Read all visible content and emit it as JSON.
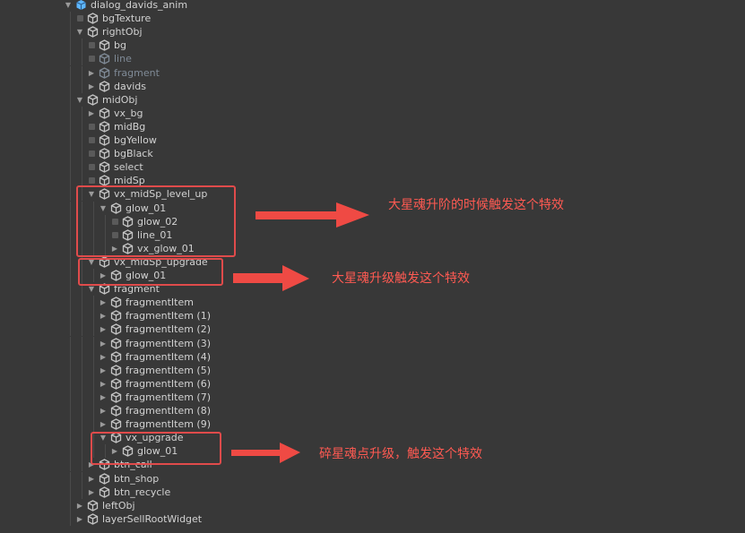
{
  "hierarchy": [
    {
      "label": "dialog_davids_anim",
      "depth": 0,
      "expand": "down",
      "prefab": "main"
    },
    {
      "label": "bgTexture",
      "depth": 1,
      "expand": "none"
    },
    {
      "label": "rightObj",
      "depth": 1,
      "expand": "down"
    },
    {
      "label": "bg",
      "depth": 2,
      "expand": "none"
    },
    {
      "label": "line",
      "depth": 2,
      "expand": "none",
      "disabled": true
    },
    {
      "label": "fragment",
      "depth": 2,
      "expand": "right",
      "disabled": true
    },
    {
      "label": "davids",
      "depth": 2,
      "expand": "right"
    },
    {
      "label": "midObj",
      "depth": 1,
      "expand": "down"
    },
    {
      "label": "vx_bg",
      "depth": 2,
      "expand": "right"
    },
    {
      "label": "midBg",
      "depth": 2,
      "expand": "none"
    },
    {
      "label": "bgYellow",
      "depth": 2,
      "expand": "none"
    },
    {
      "label": "bgBlack",
      "depth": 2,
      "expand": "none"
    },
    {
      "label": "select",
      "depth": 2,
      "expand": "none"
    },
    {
      "label": "midSp",
      "depth": 2,
      "expand": "none"
    },
    {
      "label": "vx_midSp_level_up",
      "depth": 2,
      "expand": "down"
    },
    {
      "label": "glow_01",
      "depth": 3,
      "expand": "down"
    },
    {
      "label": "glow_02",
      "depth": 4,
      "expand": "none"
    },
    {
      "label": "line_01",
      "depth": 4,
      "expand": "none"
    },
    {
      "label": "vx_glow_01",
      "depth": 4,
      "expand": "right"
    },
    {
      "label": "vx_midSp_upgrade",
      "depth": 2,
      "expand": "down"
    },
    {
      "label": "glow_01",
      "depth": 3,
      "expand": "right"
    },
    {
      "label": "fragment",
      "depth": 2,
      "expand": "down"
    },
    {
      "label": "fragmentItem",
      "depth": 3,
      "expand": "right"
    },
    {
      "label": "fragmentItem (1)",
      "depth": 3,
      "expand": "right"
    },
    {
      "label": "fragmentItem (2)",
      "depth": 3,
      "expand": "right"
    },
    {
      "label": "fragmentItem (3)",
      "depth": 3,
      "expand": "right"
    },
    {
      "label": "fragmentItem (4)",
      "depth": 3,
      "expand": "right"
    },
    {
      "label": "fragmentItem (5)",
      "depth": 3,
      "expand": "right"
    },
    {
      "label": "fragmentItem (6)",
      "depth": 3,
      "expand": "right"
    },
    {
      "label": "fragmentItem (7)",
      "depth": 3,
      "expand": "right"
    },
    {
      "label": "fragmentItem (8)",
      "depth": 3,
      "expand": "right"
    },
    {
      "label": "fragmentItem (9)",
      "depth": 3,
      "expand": "right"
    },
    {
      "label": "vx_upgrade",
      "depth": 3,
      "expand": "down"
    },
    {
      "label": "glow_01",
      "depth": 4,
      "expand": "right"
    },
    {
      "label": "btn_call",
      "depth": 2,
      "expand": "right"
    },
    {
      "label": "btn_shop",
      "depth": 2,
      "expand": "right"
    },
    {
      "label": "btn_recycle",
      "depth": 2,
      "expand": "right"
    },
    {
      "label": "leftObj",
      "depth": 1,
      "expand": "right"
    },
    {
      "label": "layerSellRootWidget",
      "depth": 1,
      "expand": "right"
    }
  ],
  "annotations": [
    {
      "text": "大星魂升阶的时候触发这个特效"
    },
    {
      "text": "大星魂升级触发这个特效"
    },
    {
      "text": "碎星魂点升级，触发这个特效"
    }
  ],
  "colors": {
    "background": "#383838",
    "text": "#d2d2d2",
    "disabled_text": "#7f8a96",
    "icon": "#c4c4c4",
    "main_prefab_icon": "#5db5ff",
    "annotation": "#ff5a52"
  },
  "icons": {
    "expand_down": "triangle-down-icon",
    "expand_right": "triangle-right-icon",
    "object": "cube-icon"
  }
}
